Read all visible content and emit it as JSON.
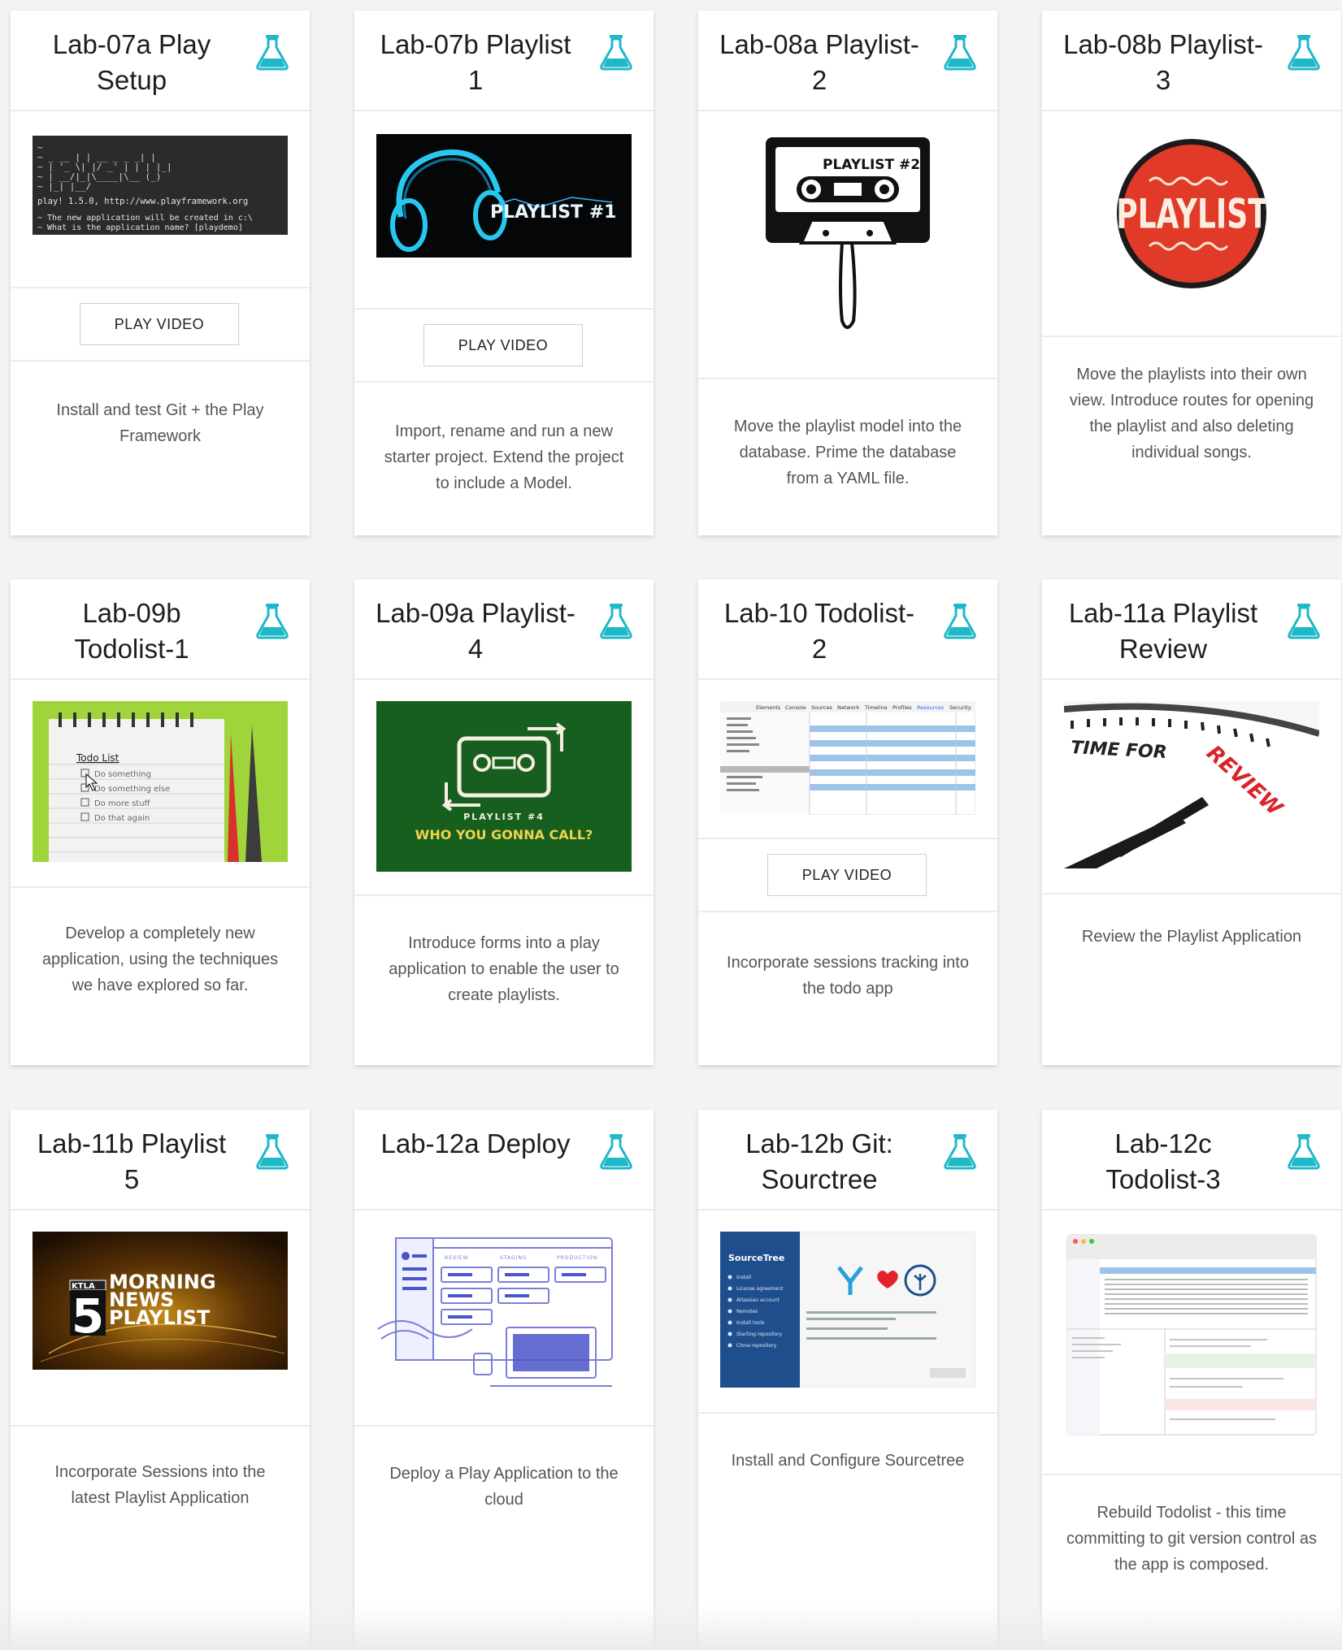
{
  "colors": {
    "accent": "#1fb8c8",
    "card_bg": "#ffffff",
    "page_bg": "#f3f3f3"
  },
  "cards": [
    {
      "title": "Lab-07a Play Setup",
      "icon": "flask-icon",
      "thumbnail": "terminal-screenshot",
      "button": "PLAY VIDEO",
      "desc": "Install and test Git + the Play Framework",
      "thumb_text": [
        "play! 1.5.0, http://www.playframework.org",
        "~ The new application will be created in c:\\",
        "~ What is the application name? [playdemo]"
      ]
    },
    {
      "title": "Lab-07b Playlist 1",
      "icon": "flask-icon",
      "thumbnail": "headphones-image",
      "button": "PLAY VIDEO",
      "desc": "Import, rename and run a new starter project. Extend the project to include a Model.",
      "thumb_text": "PLAYLIST #1"
    },
    {
      "title": "Lab-08a Playlist-2",
      "icon": "flask-icon",
      "thumbnail": "cassette-image",
      "button": "",
      "desc": "Move the playlist model into the database. Prime the database from a YAML file.",
      "thumb_text": "PLAYLIST #2"
    },
    {
      "title": "Lab-08b Playlist-3",
      "icon": "flask-icon",
      "thumbnail": "playlist-badge",
      "button": "",
      "desc": "Move the playlists into their own view. Introduce routes for opening the playlist and also deleting individual songs.",
      "thumb_text": "PLAYLIST"
    },
    {
      "title": "Lab-09b Todolist-1",
      "icon": "flask-icon",
      "thumbnail": "notepad-image",
      "button": "",
      "desc": "Develop a completely new application, using the techniques we have explored so far.",
      "thumb_text": [
        "Todo List",
        "Do something",
        "Do something else",
        "Do more stuff",
        "Do that again"
      ]
    },
    {
      "title": "Lab-09a Playlist-4",
      "icon": "flask-icon",
      "thumbnail": "cassette-green-image",
      "button": "",
      "desc": "Introduce forms into a play application to enable the user to create playlists.",
      "thumb_text": [
        "PLAYLIST #4",
        "WHO YOU GONNA CALL?"
      ]
    },
    {
      "title": "Lab-10 Todolist-2",
      "icon": "flask-icon",
      "thumbnail": "devtools-screenshot",
      "button": "PLAY VIDEO",
      "desc": "Incorporate sessions tracking into the todo app",
      "thumb_text": [
        "Elements",
        "Console",
        "Sources",
        "Network",
        "Timeline",
        "Profiles",
        "Resources",
        "Security"
      ]
    },
    {
      "title": "Lab-11a Playlist Review",
      "icon": "flask-icon",
      "thumbnail": "clock-image",
      "button": "",
      "desc": "Review the Playlist Application",
      "thumb_text": [
        "TIME FOR",
        "REVIEW"
      ]
    },
    {
      "title": "Lab-11b Playlist 5",
      "icon": "flask-icon",
      "thumbnail": "ktla-image",
      "button": "",
      "desc": "Incorporate Sessions into the latest Playlist Application",
      "thumb_text": [
        "KTLA",
        "5",
        "MORNING",
        "NEWS",
        "PLAYLIST"
      ]
    },
    {
      "title": "Lab-12a Deploy",
      "icon": "flask-icon",
      "thumbnail": "deploy-illustration",
      "button": "",
      "desc": "Deploy a Play Application to the cloud",
      "thumb_text": [
        "REVIEW",
        "STAGING",
        "PRODUCTION"
      ]
    },
    {
      "title": "Lab-12b Git: Sourctree",
      "icon": "flask-icon",
      "thumbnail": "sourcetree-screenshot",
      "button": "",
      "desc": "Install and Configure Sourcetree",
      "thumb_text": [
        "SourceTree",
        "Install",
        "License agreement",
        "Atlassian account",
        "Remotes",
        "Install tools",
        "Starting repository",
        "Clone repository"
      ]
    },
    {
      "title": "Lab-12c Todolist-3",
      "icon": "flask-icon",
      "thumbnail": "sourcetree-app-screenshot",
      "button": "",
      "desc": "Rebuild Todolist - this time committing to git version control as the app is composed.",
      "thumb_text": ""
    }
  ]
}
